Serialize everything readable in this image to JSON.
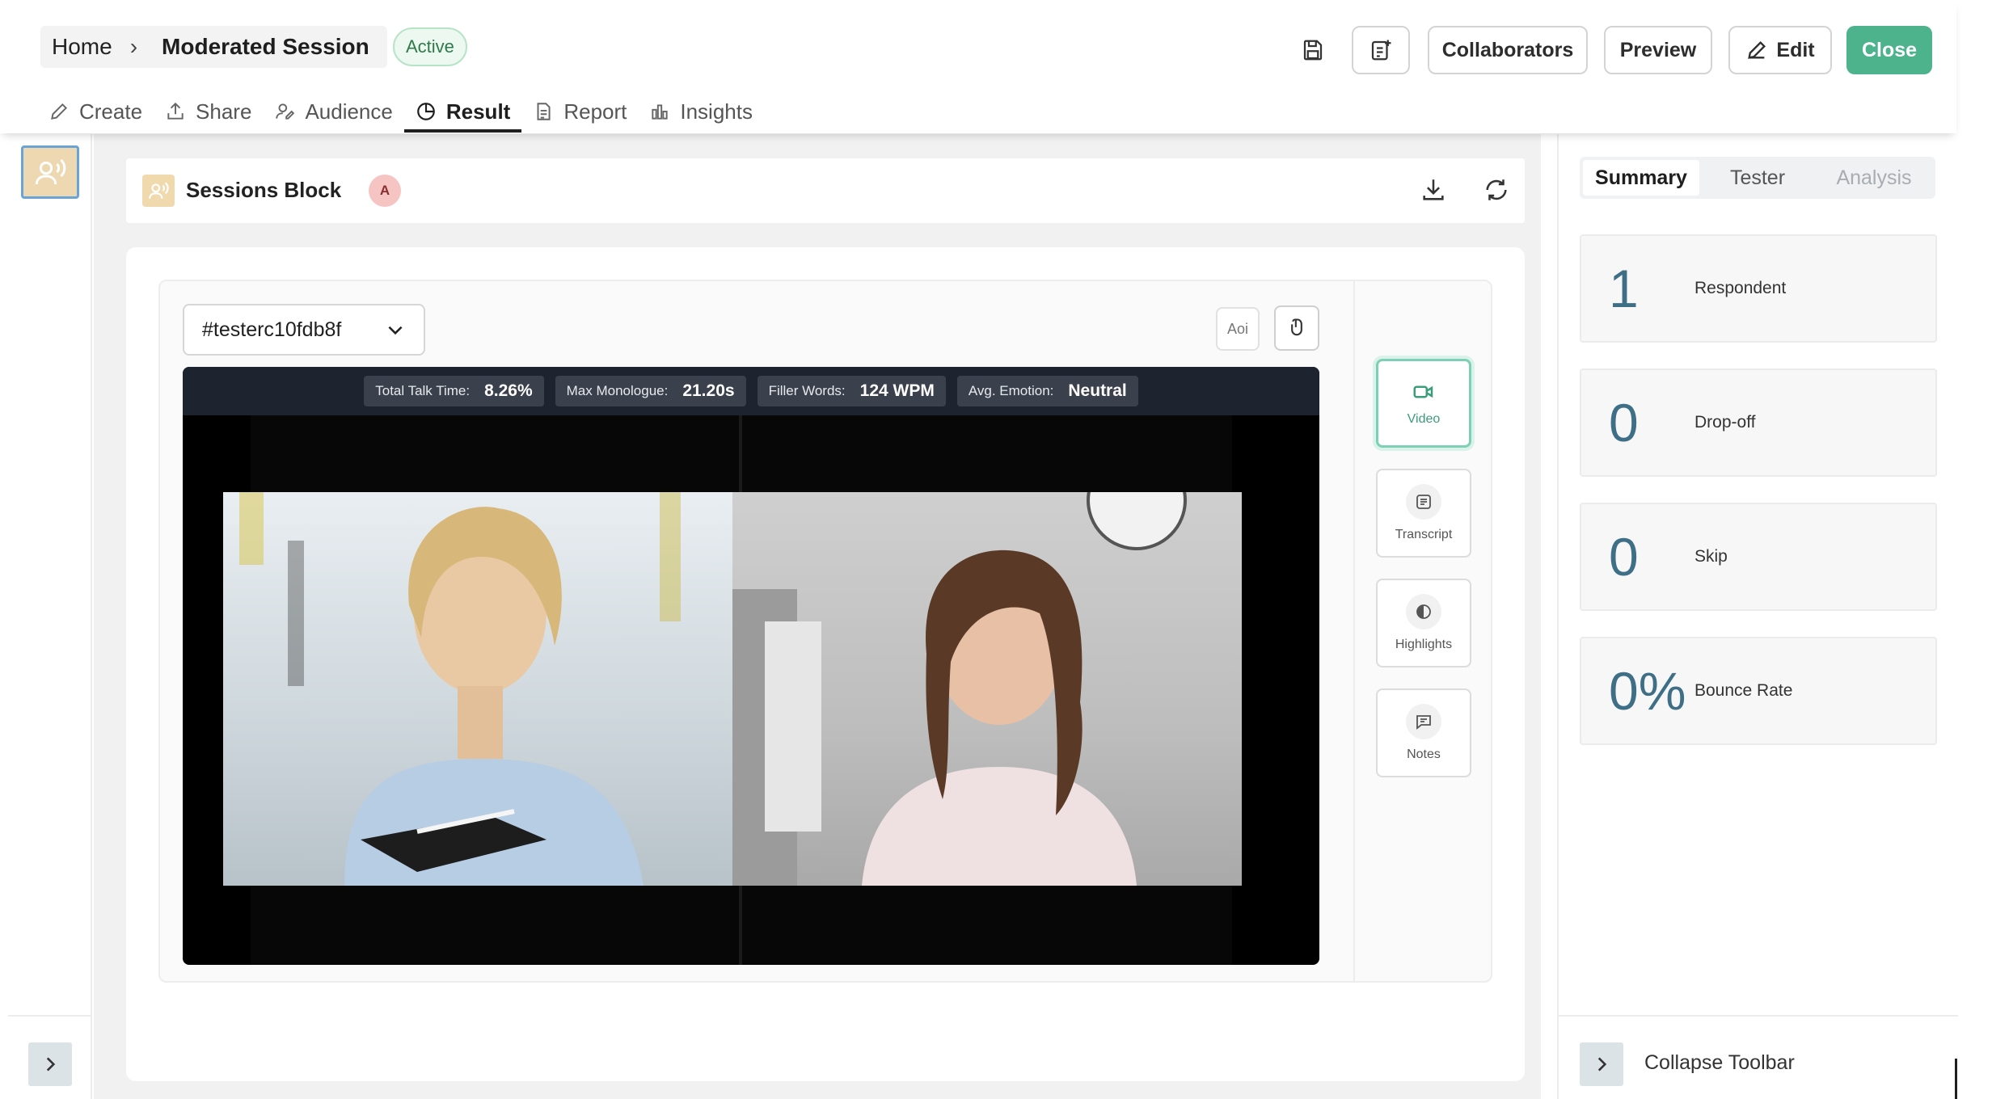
{
  "breadcrumb": {
    "home": "Home",
    "separator": "›",
    "title": "Moderated Session"
  },
  "status_badge": "Active",
  "header_buttons": {
    "collaborators": "Collaborators",
    "preview": "Preview",
    "edit": "Edit",
    "close": "Close"
  },
  "tabs": [
    {
      "label": "Create",
      "icon": "pencil-icon"
    },
    {
      "label": "Share",
      "icon": "share-icon"
    },
    {
      "label": "Audience",
      "icon": "audience-icon"
    },
    {
      "label": "Result",
      "icon": "result-chart-icon",
      "active": true
    },
    {
      "label": "Report",
      "icon": "report-icon"
    },
    {
      "label": "Insights",
      "icon": "insights-icon"
    }
  ],
  "block": {
    "title": "Sessions Block",
    "avatar": "A"
  },
  "tester_select": {
    "value": "#testerc10fdb8f"
  },
  "aoi_label": "Aoi",
  "metrics": [
    {
      "label": "Total Talk Time:",
      "value": "8.26%"
    },
    {
      "label": "Max Monologue:",
      "value": "21.20s"
    },
    {
      "label": "Filler Words:",
      "value": "124 WPM"
    },
    {
      "label": "Avg. Emotion:",
      "value": "Neutral"
    }
  ],
  "side_tools": [
    {
      "label": "Video",
      "icon": "video-icon",
      "active": true
    },
    {
      "label": "Transcript",
      "icon": "transcript-icon"
    },
    {
      "label": "Highlights",
      "icon": "highlights-icon"
    },
    {
      "label": "Notes",
      "icon": "notes-icon"
    }
  ],
  "right_panel": {
    "tabs": [
      {
        "label": "Summary",
        "active": true
      },
      {
        "label": "Tester"
      },
      {
        "label": "Analysis",
        "disabled": true
      }
    ],
    "stats": [
      {
        "value": "1",
        "label": "Respondent"
      },
      {
        "value": "0",
        "label": "Drop-off"
      },
      {
        "value": "0",
        "label": "Skip"
      },
      {
        "value": "0%",
        "label": "Bounce Rate"
      }
    ],
    "collapse_label": "Collapse Toolbar"
  },
  "colors": {
    "accent": "#4cb38c",
    "stat_value": "#3e6f86",
    "badge_text": "#2f7a49"
  }
}
